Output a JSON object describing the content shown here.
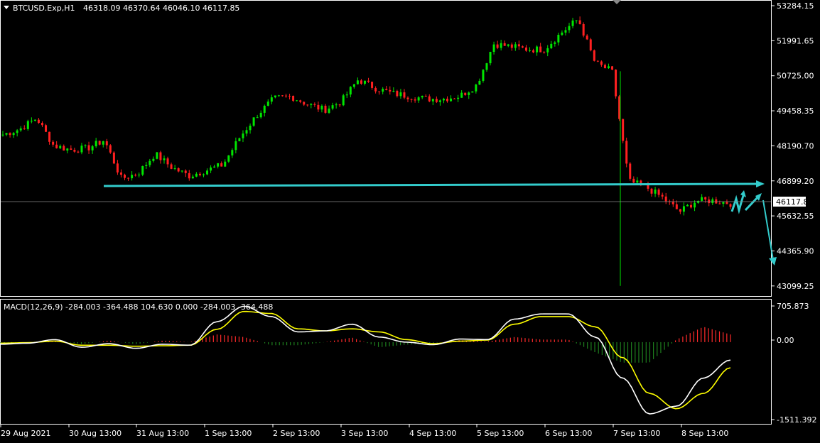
{
  "main": {
    "header": {
      "symbol": "BTCUSD.Exp,H1",
      "ohlc": "46318.09 46370.64 46046.10 46117.85"
    },
    "current_price_label": "46117.85",
    "price_ticks": [
      "53284.15",
      "51991.65",
      "50725.00",
      "49458.35",
      "48190.70",
      "46899.20",
      "45632.55",
      "44365.90",
      "43099.25"
    ]
  },
  "macd": {
    "label": "MACD(12,26,9) -284.003 -364.488 104.630 0.000 -284.003 -364.488",
    "ticks": [
      "705.873",
      "0.00",
      "-1511.392"
    ]
  },
  "time_ticks": [
    "29 Aug 2021",
    "30 Aug 13:00",
    "31 Aug 13:00",
    "1 Sep 13:00",
    "2 Sep 13:00",
    "3 Sep 13:00",
    "4 Sep 13:00",
    "5 Sep 13:00",
    "6 Sep 13:00",
    "7 Sep 13:00",
    "8 Sep 13:00"
  ],
  "chart_data": [
    {
      "type": "candlestick",
      "title": "BTCUSD.Exp,H1",
      "x": [
        "29 Aug",
        "30 Aug",
        "31 Aug",
        "1 Sep",
        "2 Sep",
        "3 Sep",
        "4 Sep",
        "5 Sep",
        "6 Sep",
        "7 Sep",
        "8 Sep"
      ],
      "close_path": [
        [
          "29 Aug 00:00",
          48600
        ],
        [
          "29 Aug 06:00",
          48800
        ],
        [
          "29 Aug 12:00",
          49200
        ],
        [
          "29 Aug 18:00",
          48200
        ],
        [
          "30 Aug 00:00",
          48050
        ],
        [
          "30 Aug 06:00",
          48100
        ],
        [
          "30 Aug 12:00",
          48400
        ],
        [
          "30 Aug 18:00",
          47000
        ],
        [
          "31 Aug 00:00",
          47200
        ],
        [
          "31 Aug 06:00",
          47900
        ],
        [
          "31 Aug 12:00",
          47400
        ],
        [
          "31 Aug 18:00",
          47100
        ],
        [
          "1 Sep 00:00",
          47300
        ],
        [
          "1 Sep 06:00",
          47500
        ],
        [
          "1 Sep 12:00",
          48500
        ],
        [
          "1 Sep 18:00",
          49300
        ],
        [
          "2 Sep 00:00",
          49900
        ],
        [
          "2 Sep 06:00",
          50000
        ],
        [
          "2 Sep 12:00",
          49700
        ],
        [
          "2 Sep 18:00",
          49500
        ],
        [
          "3 Sep 00:00",
          49800
        ],
        [
          "3 Sep 06:00",
          50600
        ],
        [
          "3 Sep 12:00",
          50300
        ],
        [
          "3 Sep 18:00",
          50100
        ],
        [
          "4 Sep 00:00",
          50000
        ],
        [
          "4 Sep 06:00",
          49900
        ],
        [
          "4 Sep 12:00",
          49900
        ],
        [
          "4 Sep 18:00",
          50000
        ],
        [
          "5 Sep 00:00",
          50400
        ],
        [
          "5 Sep 06:00",
          51900
        ],
        [
          "5 Sep 12:00",
          51800
        ],
        [
          "5 Sep 18:00",
          51700
        ],
        [
          "6 Sep 00:00",
          51700
        ],
        [
          "6 Sep 06:00",
          52300
        ],
        [
          "6 Sep 12:00",
          52800
        ],
        [
          "6 Sep 18:00",
          51200
        ],
        [
          "7 Sep 00:00",
          50900
        ],
        [
          "7 Sep 06:00",
          46900
        ],
        [
          "7 Sep 12:00",
          46700
        ],
        [
          "7 Sep 18:00",
          46300
        ],
        [
          "8 Sep 00:00",
          45800
        ],
        [
          "8 Sep 06:00",
          46200
        ],
        [
          "8 Sep 12:00",
          46200
        ],
        [
          "8 Sep 18:00",
          46100
        ]
      ],
      "extremes": {
        "high": 52850,
        "low": 43099
      },
      "support_line": 46899.2,
      "current_price": 46117.85,
      "ylim": [
        43099.25,
        53284.15
      ]
    },
    {
      "type": "line",
      "title": "MACD(12,26,9)",
      "ylim": [
        -1511.392,
        705.873
      ],
      "series": [
        {
          "name": "MACD",
          "values": [
            -40,
            -20,
            50,
            -100,
            -30,
            -120,
            -40,
            -60,
            400,
            700,
            500,
            200,
            220,
            350,
            100,
            0,
            -50,
            60,
            50,
            450,
            550,
            550,
            100,
            -700,
            -1400,
            -1250,
            -700,
            -350
          ]
        },
        {
          "name": "Signal",
          "values": [
            -20,
            -10,
            20,
            -60,
            -60,
            -80,
            -70,
            -60,
            250,
            600,
            560,
            260,
            220,
            260,
            200,
            50,
            -30,
            20,
            40,
            350,
            500,
            500,
            300,
            -300,
            -1000,
            -1300,
            -1000,
            -500
          ]
        },
        {
          "name": "Histogram",
          "values": [
            -20,
            -10,
            30,
            -40,
            30,
            -40,
            30,
            0,
            150,
            100,
            -60,
            -60,
            0,
            90,
            -100,
            -50,
            -20,
            40,
            10,
            100,
            50,
            50,
            -200,
            -400,
            -400,
            50,
            300,
            150
          ]
        }
      ],
      "colors": {
        "macd": "#ffffff",
        "signal": "#ffff00",
        "hist_up": "#ff2a2a",
        "hist_down": "#1e7f1e"
      }
    }
  ],
  "colors": {
    "bull": "#00e600",
    "bear": "#ff2020",
    "arrow": "#33cccc",
    "axis": "#ffffff",
    "background": "#000000"
  }
}
